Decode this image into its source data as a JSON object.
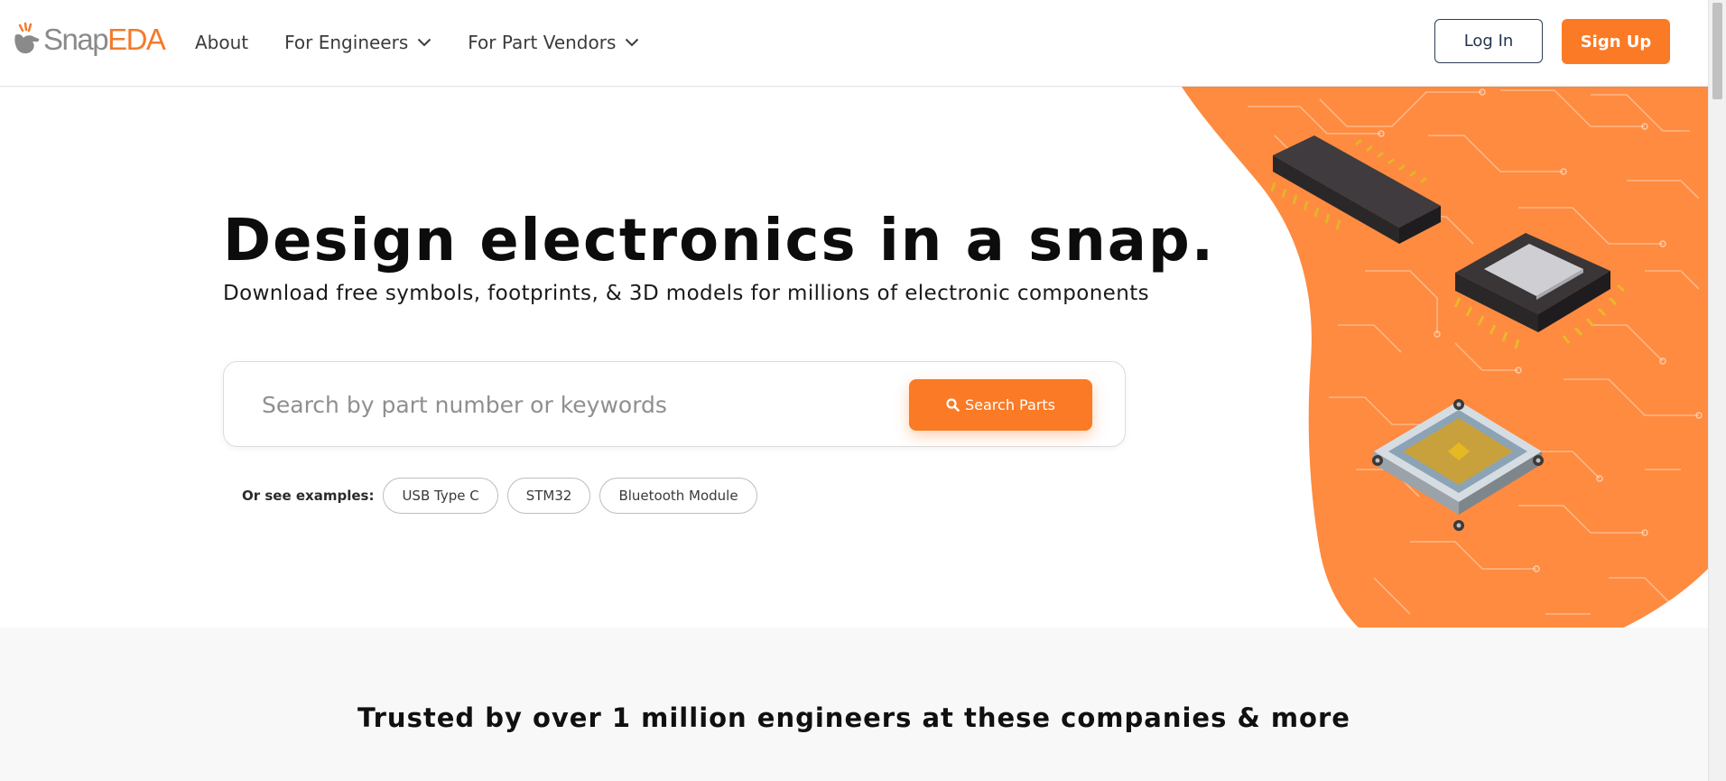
{
  "header": {
    "logo": {
      "part1": "Snap",
      "part2": "EDA"
    },
    "nav": [
      {
        "label": "About",
        "has_dropdown": false
      },
      {
        "label": "For Engineers",
        "has_dropdown": true
      },
      {
        "label": "For Part Vendors",
        "has_dropdown": true
      }
    ],
    "login_label": "Log In",
    "signup_label": "Sign Up"
  },
  "hero": {
    "headline": "Design electronics in a snap.",
    "subheadline": "Download free symbols, footprints, & 3D models for millions of electronic components",
    "search": {
      "placeholder": "Search by part number or keywords",
      "value": "",
      "button_label": "Search Parts",
      "button_icon": "search-icon"
    },
    "examples": {
      "label": "Or see examples:",
      "chips": [
        "USB Type C",
        "STM32",
        "Bluetooth Module"
      ]
    }
  },
  "trusted": {
    "title": "Trusted by over 1 million engineers at these companies & more"
  },
  "colors": {
    "brand_orange": "#fb7a25",
    "art_orange": "#fe8b40",
    "login_border": "#2c3d55",
    "logo_gray": "#8a8a8a",
    "section_bg": "#f8f8f8"
  }
}
